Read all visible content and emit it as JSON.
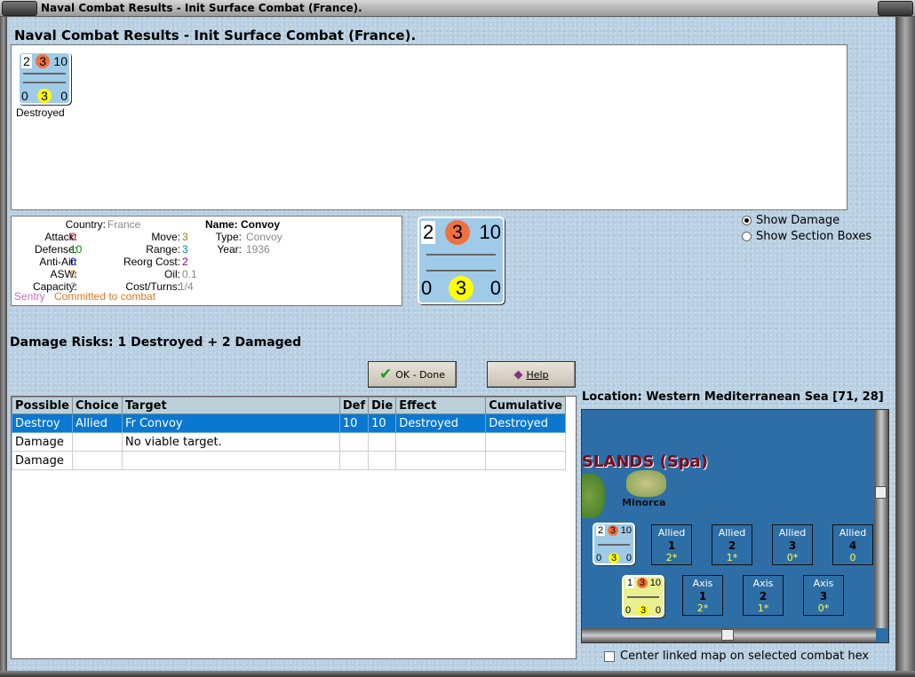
{
  "window": {
    "title": "Naval Combat Results - Init Surface Combat (France)."
  },
  "header": "Naval Combat Results - Init Surface Combat (France).",
  "unit_counter": {
    "top": [
      "2",
      "3",
      "10"
    ],
    "bottom": [
      "0",
      "3",
      "0"
    ],
    "status": "Destroyed"
  },
  "info": {
    "country_label": "Country:",
    "country": "France",
    "attack_label": "Attack:",
    "attack": "0",
    "defense_label": "Defense:",
    "defense": "10",
    "antiair_label": "Anti-Air:",
    "antiair": "0",
    "asw_label": "ASW:",
    "asw": "0",
    "capacity_label": "Capacity:",
    "capacity": "2",
    "move_label": "Move:",
    "move": "3",
    "range_label": "Range:",
    "range": "3",
    "reorg_label": "Reorg Cost:",
    "reorg": "2",
    "oil_label": "Oil:",
    "oil": "0.1",
    "cost_label": "Cost/Turns:",
    "cost": "1/4",
    "name": "Name: Convoy",
    "type_label": "Type:",
    "type": "Convoy",
    "year_label": "Year:",
    "year": "1936",
    "sentry": "Sentry",
    "committed": "Committed to combat"
  },
  "options": {
    "show_damage": "Show Damage",
    "show_sections": "Show Section Boxes"
  },
  "damage_risks": "Damage Risks: 1 Destroyed + 2 Damaged",
  "buttons": {
    "ok": "OK - Done",
    "help": "Help"
  },
  "table": {
    "columns": [
      "Possible",
      "Choice",
      "Target",
      "Def",
      "Die",
      "Effect",
      "Cumulative"
    ],
    "rows": [
      [
        "Destroy",
        "Allied",
        "Fr Convoy",
        "10",
        "10",
        "Destroyed",
        "Destroyed"
      ],
      [
        "Damage",
        "",
        "No viable target.",
        "",
        "",
        "",
        ""
      ],
      [
        "Damage",
        "",
        "",
        "",
        "",
        "",
        ""
      ]
    ]
  },
  "location": "Location:  Western Mediterranean Sea [71, 28]",
  "map": {
    "region_label": "SLANDS (Spa)",
    "hex_label": "Minorca",
    "counter1": {
      "top": [
        "2",
        "3",
        "10"
      ],
      "bottom": [
        "0",
        "3",
        "0"
      ]
    },
    "counter2": {
      "top": [
        "1",
        "3",
        "10"
      ],
      "bottom": [
        "0",
        "3",
        "0"
      ]
    },
    "allied": [
      {
        "label": "Allied",
        "n": "1",
        "v": "2*"
      },
      {
        "label": "Allied",
        "n": "2",
        "v": "1*"
      },
      {
        "label": "Allied",
        "n": "3",
        "v": "0*"
      },
      {
        "label": "Allied",
        "n": "4",
        "v": "0"
      }
    ],
    "axis": [
      {
        "label": "Axis",
        "n": "1",
        "v": "2*"
      },
      {
        "label": "Axis",
        "n": "2",
        "v": "1*"
      },
      {
        "label": "Axis",
        "n": "3",
        "v": "0*"
      }
    ]
  },
  "center_map": "Center linked map on selected combat hex",
  "colors": {
    "selected_row": "#0a78d0",
    "sea": "#2e6ea6",
    "panel_bg": "#b9d0e2"
  }
}
